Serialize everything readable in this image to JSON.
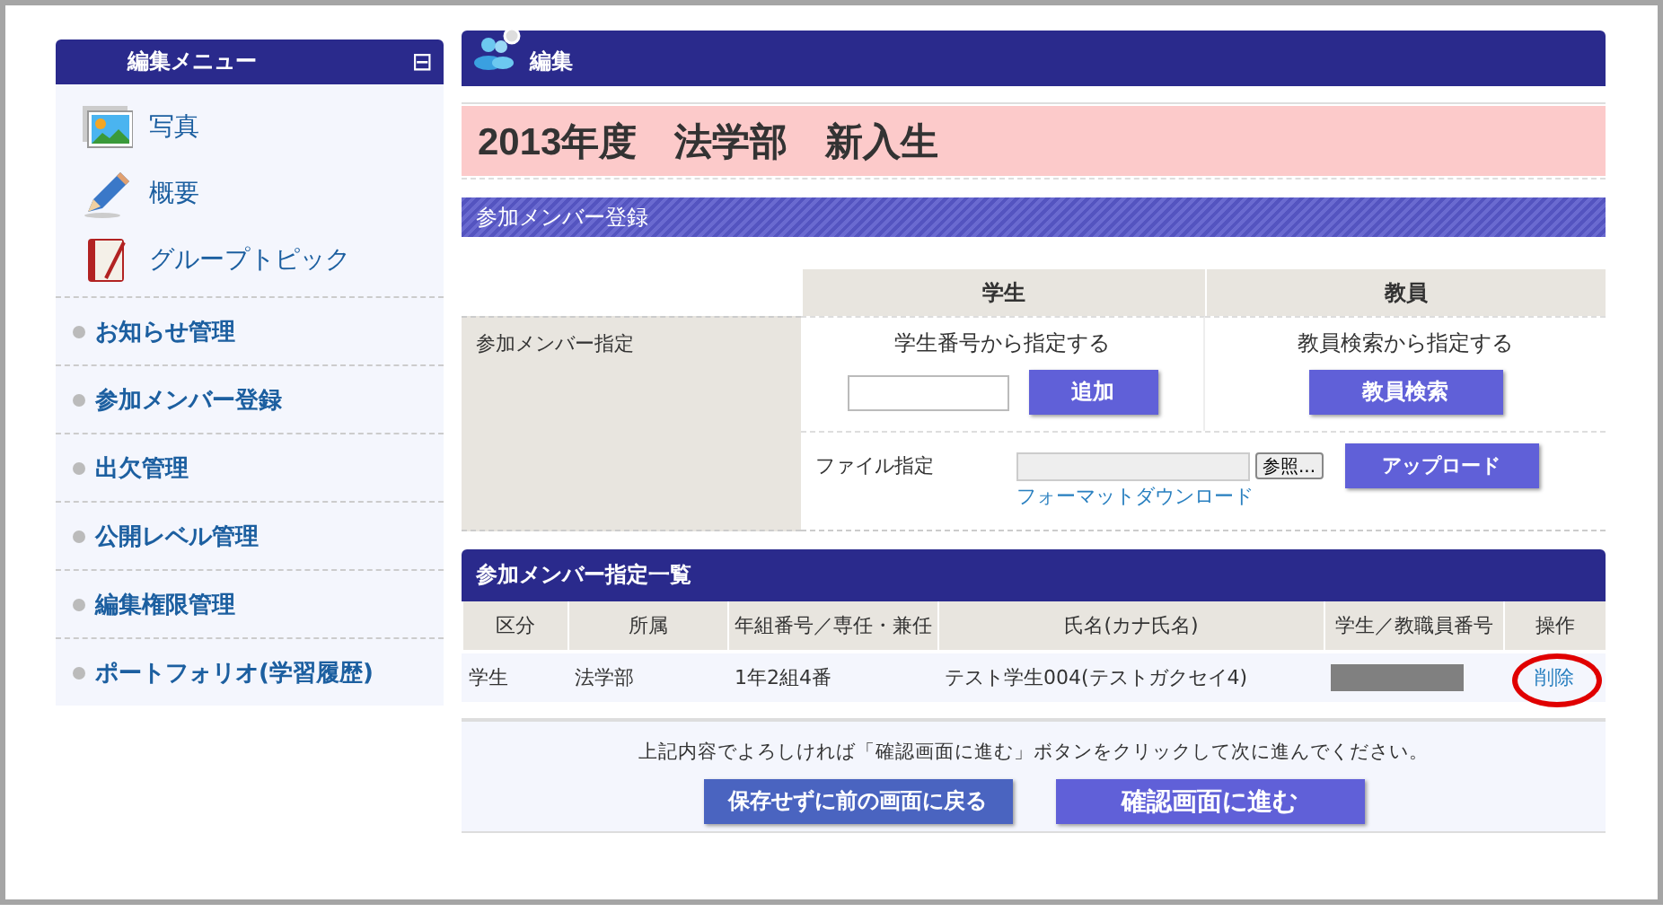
{
  "sidebar": {
    "title": "編集メニュー",
    "collapse_symbol": "⊟",
    "items": [
      {
        "kind": "large",
        "label": "写真"
      },
      {
        "kind": "large",
        "label": "概要"
      },
      {
        "kind": "large",
        "label": "グループトピック"
      },
      {
        "kind": "bullet",
        "label": "お知らせ管理"
      },
      {
        "kind": "bullet",
        "label": "参加メンバー登録"
      },
      {
        "kind": "bullet",
        "label": "出欠管理"
      },
      {
        "kind": "bullet",
        "label": "公開レベル管理"
      },
      {
        "kind": "bullet",
        "label": "編集権限管理"
      },
      {
        "kind": "bullet",
        "label": "ポートフォリオ(学習履歴)"
      }
    ]
  },
  "header": {
    "title": "編集"
  },
  "page_title": "2013年度　法学部　新入生",
  "registration": {
    "title": "参加メンバー登録",
    "columns": [
      "学生",
      "教員"
    ],
    "row_label": "参加メンバー指定",
    "student": {
      "caption": "学生番号から指定する",
      "button": "追加"
    },
    "staff": {
      "caption": "教員検索から指定する",
      "button": "教員検索"
    },
    "file": {
      "label": "ファイル指定",
      "browse": "参照...",
      "upload": "アップロード",
      "download_link": "フォーマットダウンロード"
    }
  },
  "list": {
    "title": "参加メンバー指定一覧",
    "columns": [
      "区分",
      "所属",
      "年組番号／専任・兼任",
      "氏名(カナ氏名)",
      "学生／教職員番号",
      "操作"
    ],
    "rows": [
      {
        "cells": [
          "学生",
          "法学部",
          "1年2組4番",
          "テスト学生004(テストガクセイ4)"
        ],
        "number_redacted": true,
        "action": "削除",
        "highlighted": true
      }
    ]
  },
  "footer": {
    "message": "上記内容でよろしければ「確認画面に進む」ボタンをクリックして次に進んでください。",
    "buttons": [
      {
        "kind": "secondary",
        "label": "保存せずに前の画面に戻る"
      },
      {
        "kind": "primary",
        "label": "確認画面に進む"
      }
    ]
  }
}
